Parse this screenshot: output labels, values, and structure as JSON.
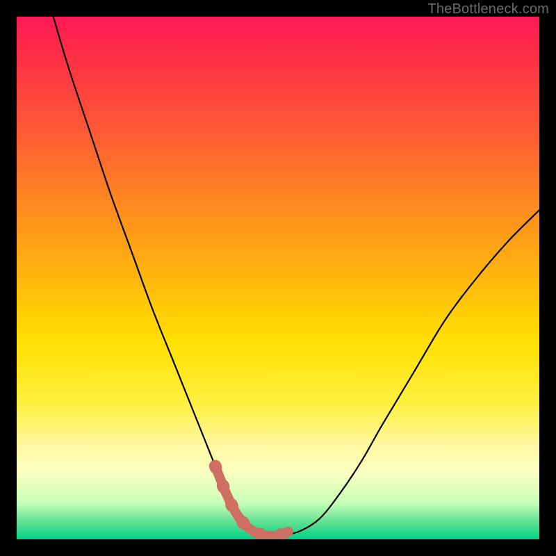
{
  "watermark": "TheBottleneck.com",
  "colors": {
    "page_bg": "#000000",
    "curve": "#000000",
    "highlight": "#cf6f63",
    "gradient_top": "#ff1a55",
    "gradient_bottom": "#00d28a"
  },
  "chart_data": {
    "type": "line",
    "title": "",
    "xlabel": "",
    "ylabel": "",
    "xlim": [
      0,
      100
    ],
    "ylim": [
      0,
      100
    ],
    "grid": false,
    "series": [
      {
        "name": "bottleneck-curve",
        "x": [
          7,
          10,
          14,
          18,
          22,
          26,
          30,
          34,
          36,
          38,
          40,
          42,
          44,
          46,
          48,
          50,
          54,
          58,
          62,
          66,
          70,
          76,
          82,
          88,
          94,
          100
        ],
        "y": [
          100,
          90,
          78,
          66,
          55,
          44,
          34,
          24,
          19,
          14,
          9,
          5,
          2.5,
          1.2,
          0.7,
          0.7,
          1.5,
          4,
          9,
          15,
          22,
          32,
          42,
          50,
          57,
          63
        ]
      },
      {
        "name": "optimal-zone-highlight",
        "x": [
          38,
          40,
          42,
          44,
          46,
          48,
          50,
          52
        ],
        "y": [
          14,
          9,
          5,
          2.5,
          1.2,
          0.7,
          0.7,
          1.5
        ]
      }
    ]
  }
}
